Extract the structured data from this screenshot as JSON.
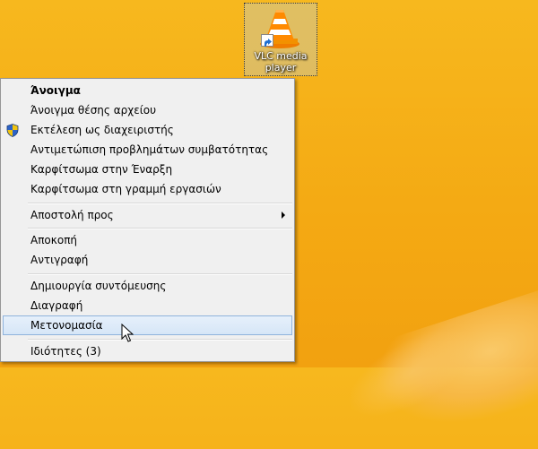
{
  "desktop": {
    "icon_label_line1": "VLC media",
    "icon_label_line2": "player",
    "icon_name": "vlc-cone-icon"
  },
  "menu": {
    "items": [
      {
        "label": "Άνοιγμα"
      },
      {
        "label": "Άνοιγμα θέσης αρχείου"
      },
      {
        "label": "Εκτέλεση ως διαχειριστής"
      },
      {
        "label": "Αντιμετώπιση προβλημάτων συμβατότητας"
      },
      {
        "label": "Καρφίτσωμα στην Έναρξη"
      },
      {
        "label": "Καρφίτσωμα στη γραμμή εργασιών"
      },
      {
        "label": "Αποστολή προς"
      },
      {
        "label": "Αποκοπή"
      },
      {
        "label": "Αντιγραφή"
      },
      {
        "label": "Δημιουργία συντόμευσης"
      },
      {
        "label": "Διαγραφή"
      },
      {
        "label": "Μετονομασία"
      },
      {
        "label": "Ιδιότητες (3)"
      }
    ]
  },
  "colors": {
    "desktop_bg": "#f4a913",
    "menu_bg": "#f0f0f0",
    "hover_bg": "#dce9f7",
    "hover_border": "#8fb3dc"
  }
}
